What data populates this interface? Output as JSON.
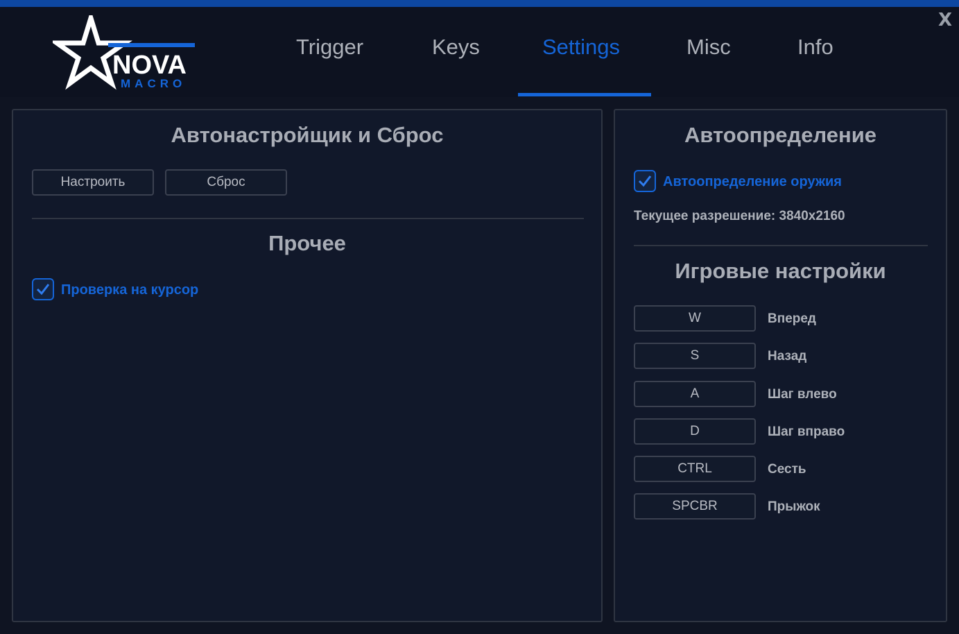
{
  "logo": {
    "brand": "NOVA",
    "sub": "MACRO"
  },
  "window": {
    "close_label": "X"
  },
  "tabs": [
    {
      "label": "Trigger"
    },
    {
      "label": "Keys"
    },
    {
      "label": "Settings",
      "active": true
    },
    {
      "label": "Misc"
    },
    {
      "label": "Info"
    }
  ],
  "left_panel": {
    "autotune_title": "Автонастройщик и Сброс",
    "tune_button": "Настроить",
    "reset_button": "Сброс",
    "other_title": "Прочее",
    "cursor_check": {
      "label": "Проверка на курсор",
      "checked": true
    }
  },
  "right_panel": {
    "autodetect_title": "Автоопределение",
    "weapon_detect": {
      "label": "Автоопределение оружия",
      "checked": true
    },
    "resolution_text": "Текущее разрешение: 3840x2160",
    "game_settings_title": "Игровые настройки",
    "keybinds": [
      {
        "key": "W",
        "action": "Вперед"
      },
      {
        "key": "S",
        "action": "Назад"
      },
      {
        "key": "A",
        "action": "Шаг влево"
      },
      {
        "key": "D",
        "action": "Шаг вправо"
      },
      {
        "key": "CTRL",
        "action": "Сесть"
      },
      {
        "key": "SPCBR",
        "action": "Прыжок"
      }
    ]
  },
  "colors": {
    "accent": "#1565d8",
    "background": "#0f1422",
    "panel_border": "#2f3542",
    "text": "#aeb2ba"
  }
}
